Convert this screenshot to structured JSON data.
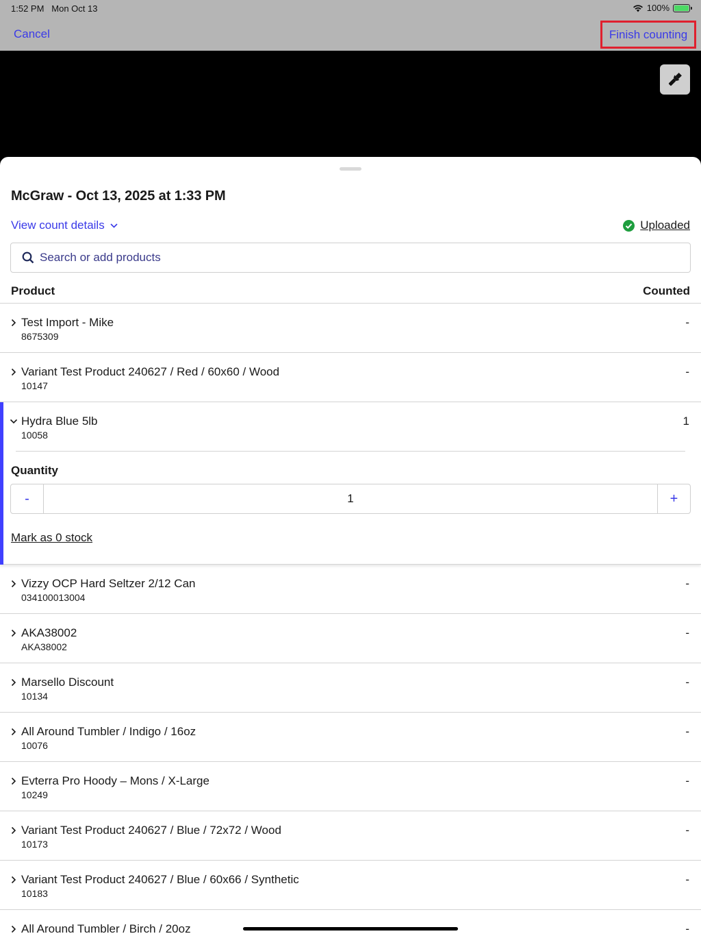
{
  "status_bar": {
    "time": "1:52 PM",
    "date": "Mon Oct 13",
    "battery": "100%",
    "battery_color": "#4cd964"
  },
  "nav": {
    "cancel_label": "Cancel",
    "finish_label": "Finish counting",
    "accent_color": "#3a3ae8",
    "highlight_color": "#e0202e"
  },
  "camera": {
    "flash_icon": "flashlight-icon"
  },
  "sheet": {
    "title": "McGraw - Oct 13, 2025 at 1:33 PM",
    "view_details_label": "View count details",
    "uploaded_label": "Uploaded",
    "uploaded_color": "#1e9e3e",
    "search_placeholder": "Search or add products",
    "columns": {
      "product": "Product",
      "counted": "Counted"
    }
  },
  "products": [
    {
      "name": "Test Import - Mike",
      "sku": "8675309",
      "counted": "-"
    },
    {
      "name": "Variant Test Product 240627 / Red / 60x60 / Wood",
      "sku": "10147",
      "counted": "-"
    },
    {
      "name": "Hydra Blue 5lb",
      "sku": "10058",
      "counted": "1",
      "expanded": true
    },
    {
      "name": "Vizzy OCP Hard Seltzer 2/12 Can",
      "sku": "034100013004",
      "counted": "-"
    },
    {
      "name": "AKA38002",
      "sku": "AKA38002",
      "counted": "-"
    },
    {
      "name": "Marsello Discount",
      "sku": "10134",
      "counted": "-"
    },
    {
      "name": "All Around Tumbler / Indigo / 16oz",
      "sku": "10076",
      "counted": "-"
    },
    {
      "name": "Evterra Pro Hoody – Mons / X-Large",
      "sku": "10249",
      "counted": "-"
    },
    {
      "name": "Variant Test Product 240627 / Blue / 72x72 / Wood",
      "sku": "10173",
      "counted": "-"
    },
    {
      "name": "Variant Test Product 240627 / Blue / 60x66 / Synthetic",
      "sku": "10183",
      "counted": "-"
    },
    {
      "name": "All Around Tumbler / Birch / 20oz",
      "sku": "",
      "counted": "-"
    }
  ],
  "expanded_panel": {
    "quantity_label": "Quantity",
    "quantity_value": "1",
    "minus_label": "-",
    "plus_label": "+",
    "mark_zero_label": "Mark as 0 stock"
  }
}
